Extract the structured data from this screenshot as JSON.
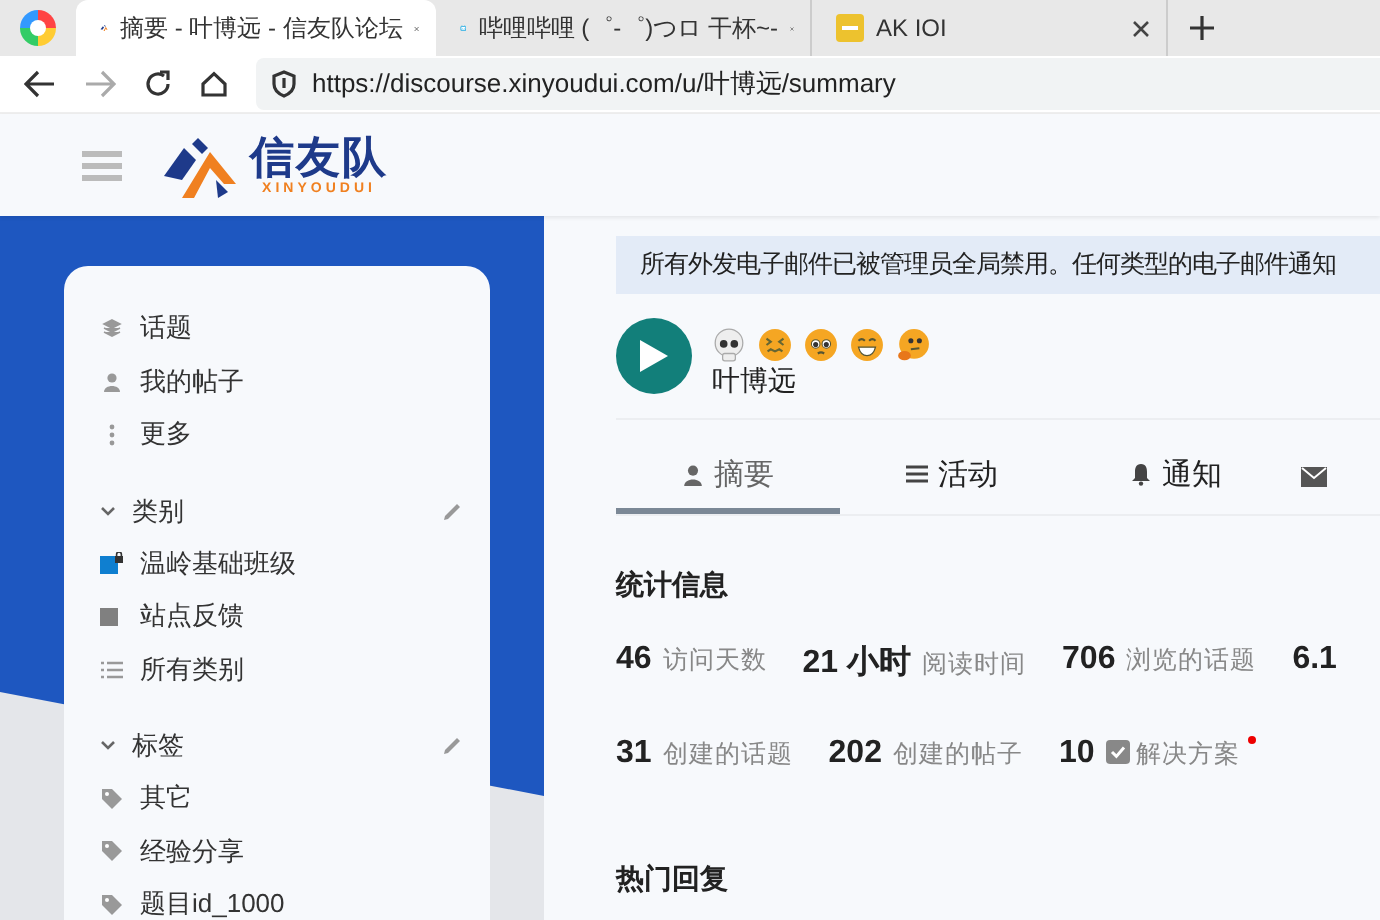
{
  "browser": {
    "tabs": [
      {
        "title": "摘要 - 叶博远 - 信友队论坛",
        "kind": "site",
        "selected": true
      },
      {
        "title": "哔哩哔哩 (゜-゜)つロ 干杯~-",
        "kind": "tv",
        "selected": false
      },
      {
        "title": "AK IOI",
        "kind": "game",
        "selected": false
      }
    ],
    "forward_disabled": true,
    "url": "https://discourse.xinyoudui.com/u/叶博远/summary"
  },
  "header": {
    "logo_text": "信友队",
    "logo_subtext": "XINYOUDUI"
  },
  "sidebar": {
    "items": [
      {
        "label": "话题",
        "kind": "topics"
      },
      {
        "label": "我的帖子",
        "kind": "user"
      },
      {
        "label": "更多",
        "kind": "more"
      }
    ],
    "sections": [
      {
        "title": "类别",
        "expanded": true,
        "items": [
          {
            "label": "温岭基础班级",
            "kind": "category",
            "color": "#0f7fd0",
            "locked": true
          },
          {
            "label": "站点反馈",
            "kind": "category",
            "color": "#808080",
            "locked": false
          },
          {
            "label": "所有类别",
            "kind": "list"
          }
        ]
      },
      {
        "title": "标签",
        "expanded": true,
        "items": [
          {
            "label": "其它",
            "kind": "tag"
          },
          {
            "label": "经验分享",
            "kind": "tag"
          },
          {
            "label": "题目id_1000",
            "kind": "tag"
          }
        ]
      }
    ]
  },
  "banner": "所有外发电子邮件已被管理员全局禁用。任何类型的电子邮件通知",
  "profile": {
    "name": "叶博远"
  },
  "tabs": [
    {
      "label": "摘要",
      "kind": "user",
      "selected": true
    },
    {
      "label": "活动",
      "kind": "list",
      "selected": false
    },
    {
      "label": "通知",
      "kind": "bell",
      "selected": false
    }
  ],
  "stats": {
    "title": "统计信息",
    "rows": [
      [
        {
          "text": "**46** 访问天数",
          "kind": "plain"
        },
        {
          "text": "**21 小时** 阅读时间",
          "kind": "plain"
        },
        {
          "text": "**706** 浏览的话题",
          "kind": "plain"
        },
        {
          "text": "**6.1**",
          "kind": "plain"
        }
      ],
      [
        {
          "text": "**31** 创建的话题",
          "kind": "plain"
        },
        {
          "text": "**202** 创建的帖子",
          "kind": "plain"
        },
        {
          "text": "**10** 解决方案",
          "kind": "solution"
        }
      ]
    ]
  },
  "top_replies": {
    "title": "热门回复"
  }
}
